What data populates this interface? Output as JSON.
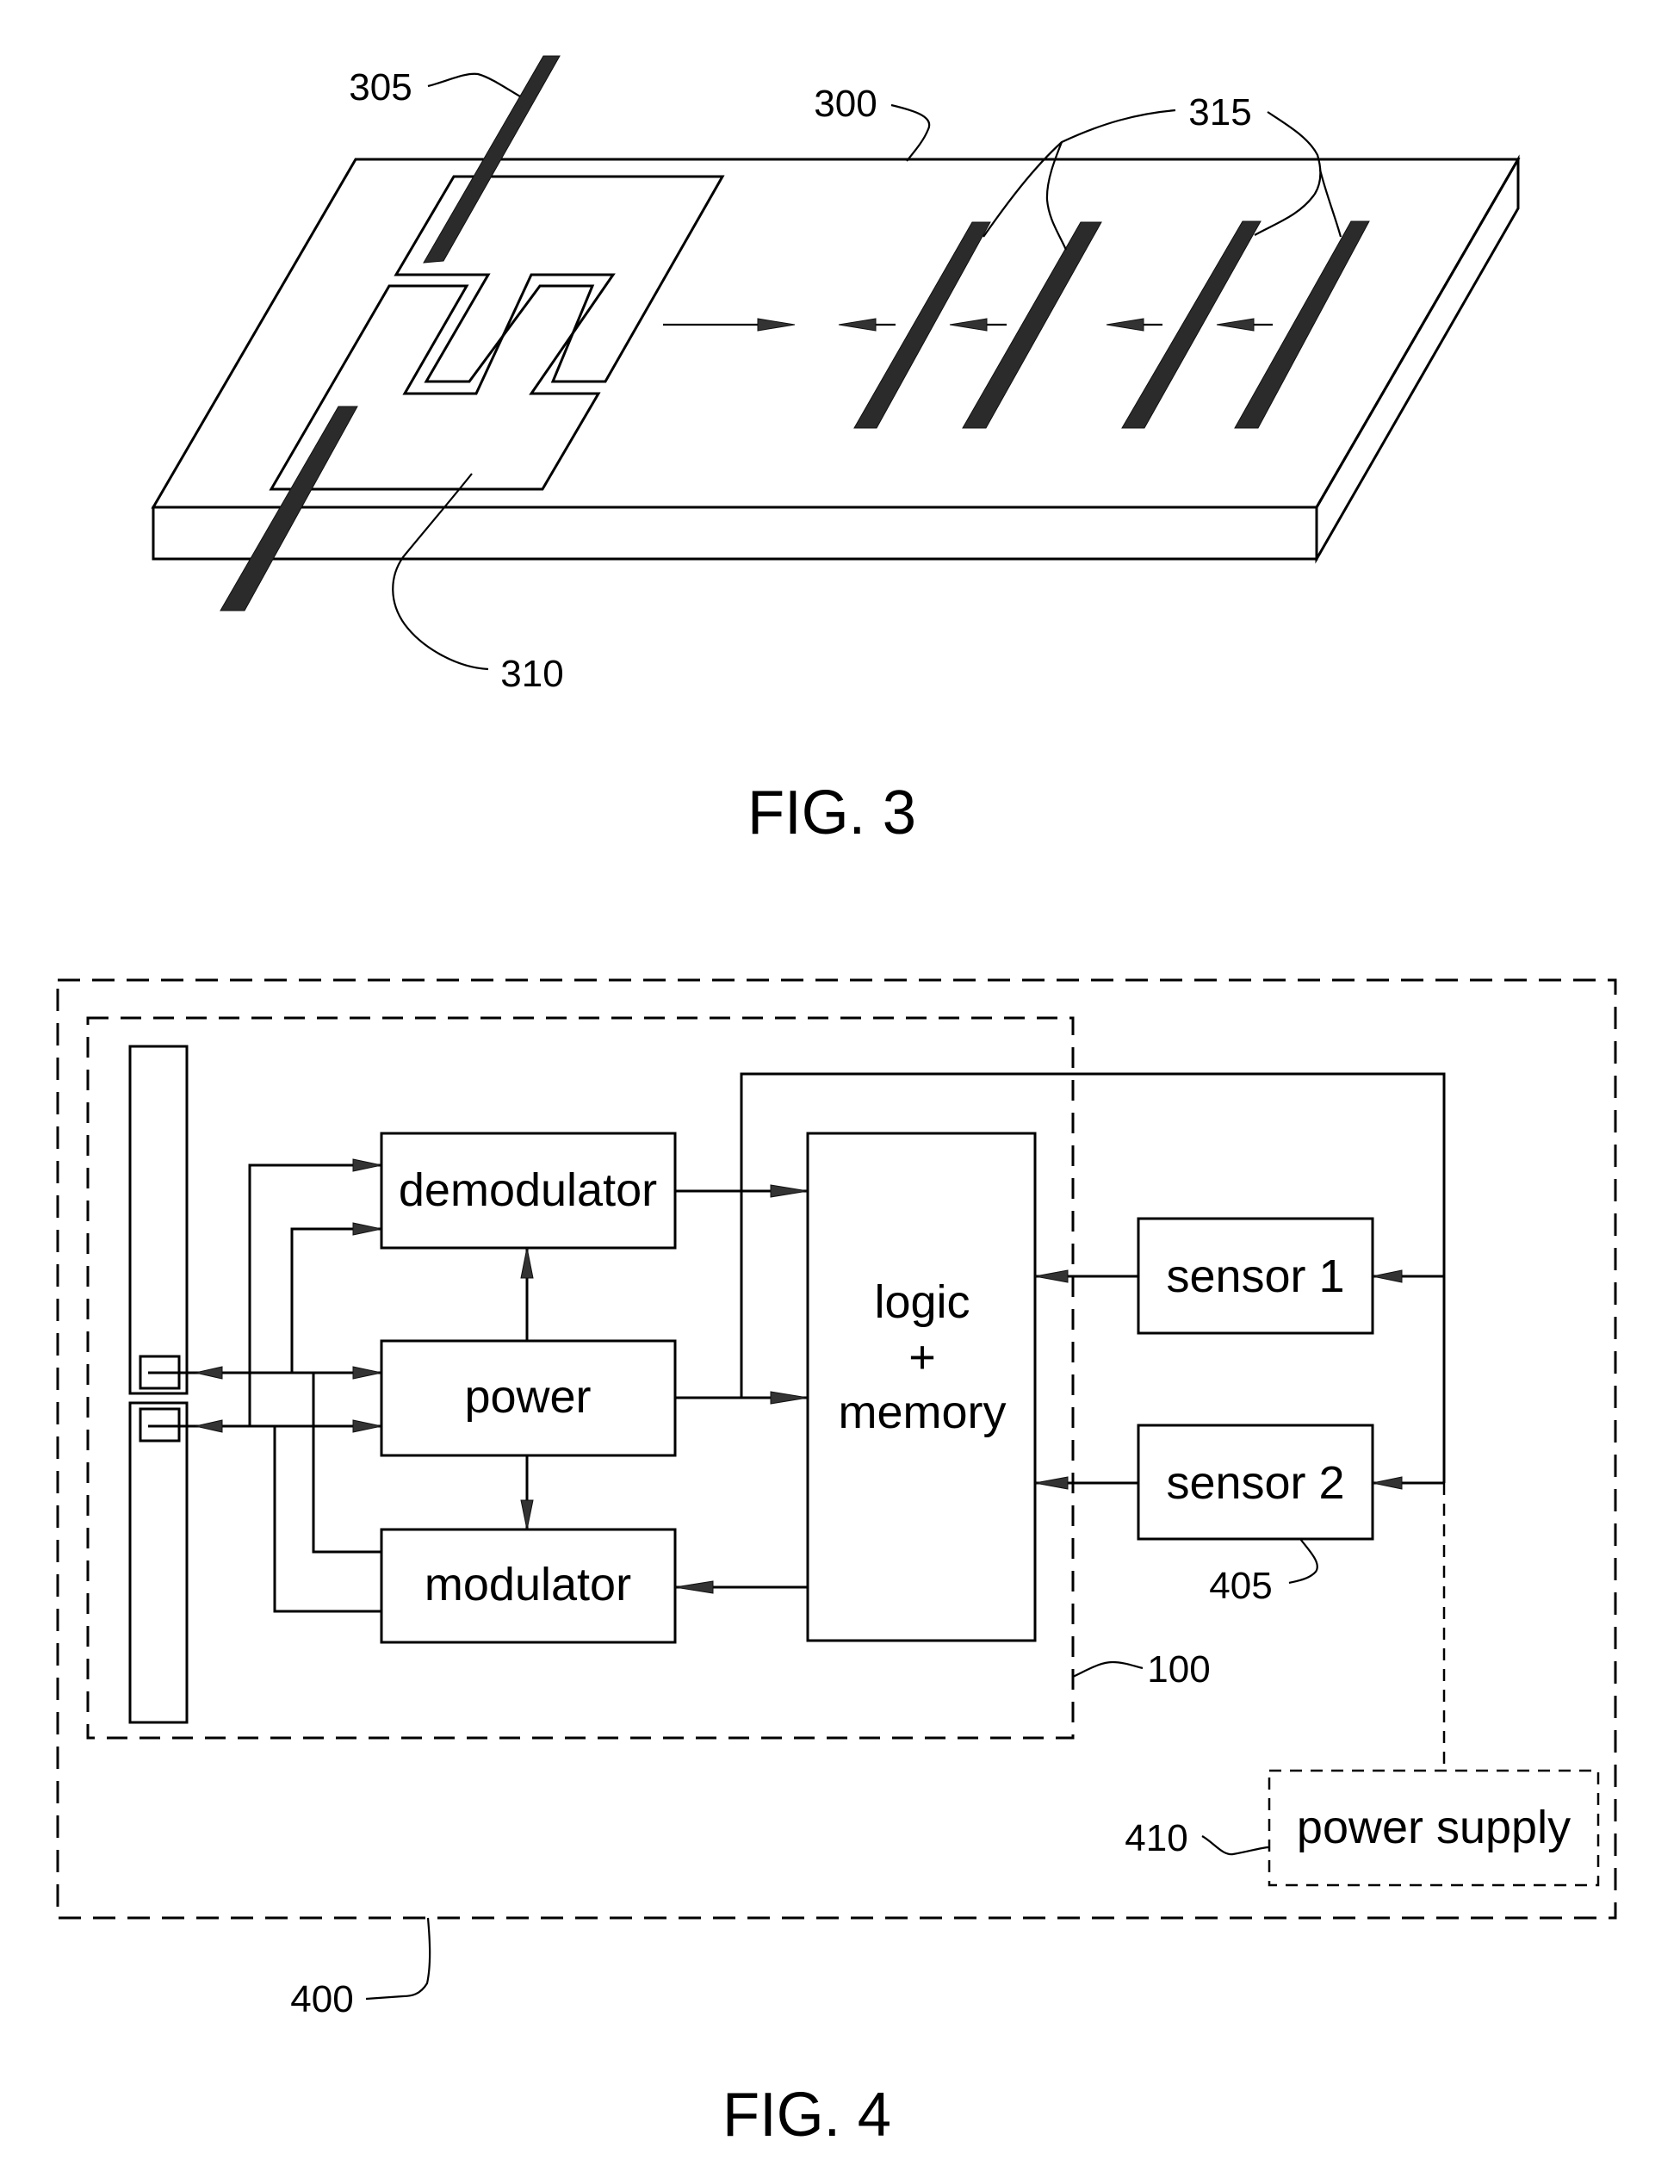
{
  "figure3": {
    "caption": "FIG. 3",
    "refs": {
      "substrate": "300",
      "antenna": "305",
      "chip_pad": "310",
      "reflectors": "315"
    }
  },
  "figure4": {
    "caption": "FIG. 4",
    "blocks": {
      "demodulator": "demodulator",
      "power": "power",
      "modulator": "modulator",
      "logic_line1": "logic",
      "logic_line2": "+",
      "logic_line3": "memory",
      "sensor1": "sensor 1",
      "sensor2": "sensor 2",
      "power_supply": "power supply"
    },
    "refs": {
      "tag": "100",
      "system": "400",
      "sensor": "405",
      "power_supply": "410"
    }
  }
}
